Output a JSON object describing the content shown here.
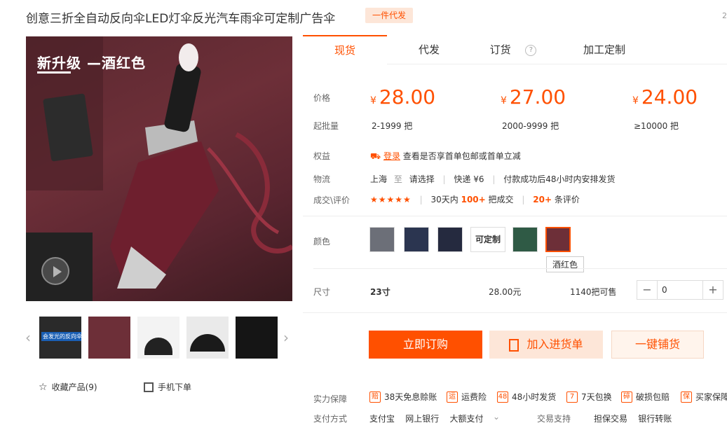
{
  "product": {
    "title": "创意三折全自动反向伞LED灯伞反光汽车雨伞可定制广告伞",
    "badge": "一件代发",
    "edge_char": "2"
  },
  "gallery": {
    "main_caption": "新升级 —酒红色",
    "thumb_captions": [
      "会发光的反向伞",
      "",
      "",
      "",
      ""
    ],
    "prev_label": "‹",
    "next_label": "›"
  },
  "actions_left": {
    "favorite_label": "收藏产品(9)",
    "mobile_label": "手机下单"
  },
  "tabs": [
    {
      "label": "现货",
      "active": true
    },
    {
      "label": "代发",
      "active": false
    },
    {
      "label": "订货",
      "active": false
    },
    {
      "label": "加工定制",
      "active": false
    }
  ],
  "pricing": {
    "price_label": "价格",
    "minq_label": "起批量",
    "currency": "¥",
    "tiers": [
      {
        "price": "28.00",
        "range": "2-1999 把"
      },
      {
        "price": "27.00",
        "range": "2000-9999 把"
      },
      {
        "price": "24.00",
        "range": "≥10000 把"
      }
    ]
  },
  "benefits": {
    "label": "权益",
    "login": "登录",
    "text": "查看是否享首单包邮或首单立减"
  },
  "logistics": {
    "label": "物流",
    "from": "上海",
    "to_word": "至",
    "select": "请选择",
    "express": "快递 ¥6",
    "dispatch": "付款成功后48小时内安排发货"
  },
  "reviews": {
    "label": "成交\\评价",
    "stars": "★★★★★",
    "prefix": "30天内",
    "count": "100+",
    "deals": "把成交",
    "review_count": "20+",
    "review_suffix": "条评价"
  },
  "colors": {
    "label": "颜色",
    "custom_label": "可定制",
    "tooltip": "酒红色",
    "swatches": [
      {
        "name": "gray",
        "color": "#6c6f78"
      },
      {
        "name": "navy",
        "color": "#2b3550"
      },
      {
        "name": "dark-blue",
        "color": "#252a3f"
      },
      {
        "name": "custom",
        "color": "#ffffff"
      },
      {
        "name": "green",
        "color": "#2f5a45"
      },
      {
        "name": "wine",
        "color": "#6d2f38"
      }
    ]
  },
  "size": {
    "label": "尺寸",
    "value": "23寸",
    "price": "28.00元",
    "stock": "1140把可售",
    "qty": "0",
    "minus": "−",
    "plus": "+"
  },
  "buttons": {
    "order": "立即订购",
    "cart": "加入进货单",
    "list": "一键铺货"
  },
  "guarantees": {
    "label": "实力保障",
    "items": [
      {
        "icon": "赔",
        "text": "38天免息赊账"
      },
      {
        "icon": "运",
        "text": "运费险"
      },
      {
        "icon": "48",
        "text": "48小时发货"
      },
      {
        "icon": "7",
        "text": "7天包换"
      },
      {
        "icon": "碎",
        "text": "破损包赔"
      },
      {
        "icon": "保",
        "text": "买家保障"
      }
    ]
  },
  "payment": {
    "label": "支付方式",
    "methods": "支付宝    网上银行    大额支付",
    "trade_label": "交易支持",
    "trade_methods": "担保交易    银行转账"
  },
  "accent": "#ff5000"
}
